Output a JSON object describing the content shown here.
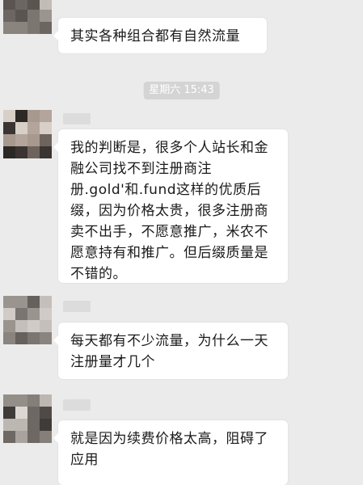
{
  "timestamp": "星期六 15:43",
  "messages": [
    {
      "text": "其实各种组合都有自然流量"
    },
    {
      "text": "我的判断是，很多个人站长和金融公司找不到注册商注册.gold'和.fund这样的优质后缀，因为价格太贵，很多注册商卖不出手，不愿意推广，米农不愿意持有和推广。但后缀质量是不错的。"
    },
    {
      "text": "每天都有不少流量，为什么一天注册量才几个"
    },
    {
      "text": "就是因为续费价格太高，阻碍了应用"
    }
  ],
  "colors": {
    "background": "#ebebeb",
    "bubble": "#ffffff",
    "timestamp_bg": "#d4d4d4",
    "timestamp_text": "#ffffff"
  }
}
